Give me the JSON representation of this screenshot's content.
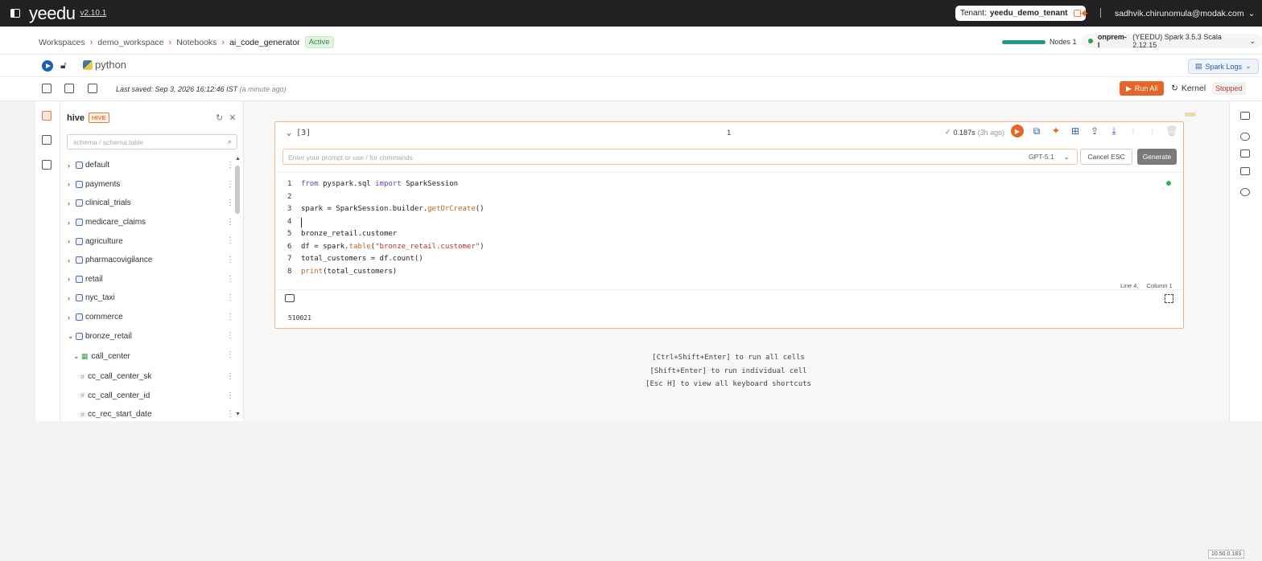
{
  "app": {
    "logo": "yeedu",
    "version": "v2.10.1",
    "tenant_label": "Tenant:",
    "tenant_name": "yeedu_demo_tenant",
    "user_email": "sadhvik.chirunomula@modak.com"
  },
  "breadcrumb": {
    "items": [
      "Workspaces",
      "demo_workspace",
      "Notebooks"
    ],
    "current": "ai_code_generator",
    "status": "Active"
  },
  "cluster": {
    "nodes_label": "Nodes 1",
    "name": "onprem-l",
    "version": "(YEEDU) Spark 3.5.3 Scala 2.12.15"
  },
  "kernel_row": {
    "language": "python",
    "spark_logs": "Spark Logs"
  },
  "toolbar": {
    "last_saved": "Last saved: Sep 3, 2026 16:12:46 IST",
    "saved_ago": "(a minute ago)",
    "run_all": "Run All",
    "kernel": "Kernel",
    "kernel_status": "Stopped"
  },
  "explorer": {
    "title": "hive",
    "badge": "HIVE",
    "search_placeholder": "schema / schema.table",
    "databases": [
      "default",
      "payments",
      "clinical_trials",
      "medicare_claims",
      "agriculture",
      "pharmacovigilance",
      "retail",
      "nyc_taxi",
      "commerce",
      "bronze_retail"
    ],
    "table": "call_center",
    "columns": [
      "cc_call_center_sk",
      "cc_call_center_id",
      "cc_rec_start_date"
    ]
  },
  "cell": {
    "exec_count": "[3]",
    "cell_number": "1",
    "timing": "0.187s",
    "timing_ago": "(3h ago)",
    "prompt_placeholder": "Enter your prompt or use / for commands",
    "model": "GPT-5.1",
    "cancel": "Cancel ESC",
    "generate": "Generate",
    "code_lines": [
      {
        "n": "1"
      },
      {
        "n": "2"
      },
      {
        "n": "3"
      },
      {
        "n": "4"
      },
      {
        "n": "5",
        "text": "bronze_retail.customer"
      },
      {
        "n": "6"
      },
      {
        "n": "7",
        "text": "total_customers = df.count()"
      },
      {
        "n": "8"
      }
    ],
    "cursor_line": "Line 4,",
    "cursor_col": "Column 1",
    "output": "510021"
  },
  "shortcuts": [
    "[Ctrl+Shift+Enter] to run all cells",
    "[Shift+Enter] to run individual cell",
    "[Esc H] to view all keyboard shortcuts"
  ],
  "footer": {
    "ip": "10.50.0.183"
  },
  "colors": {
    "accent": "#e8642a",
    "topbar": "#212121",
    "active_green": "#2e8b3a"
  }
}
